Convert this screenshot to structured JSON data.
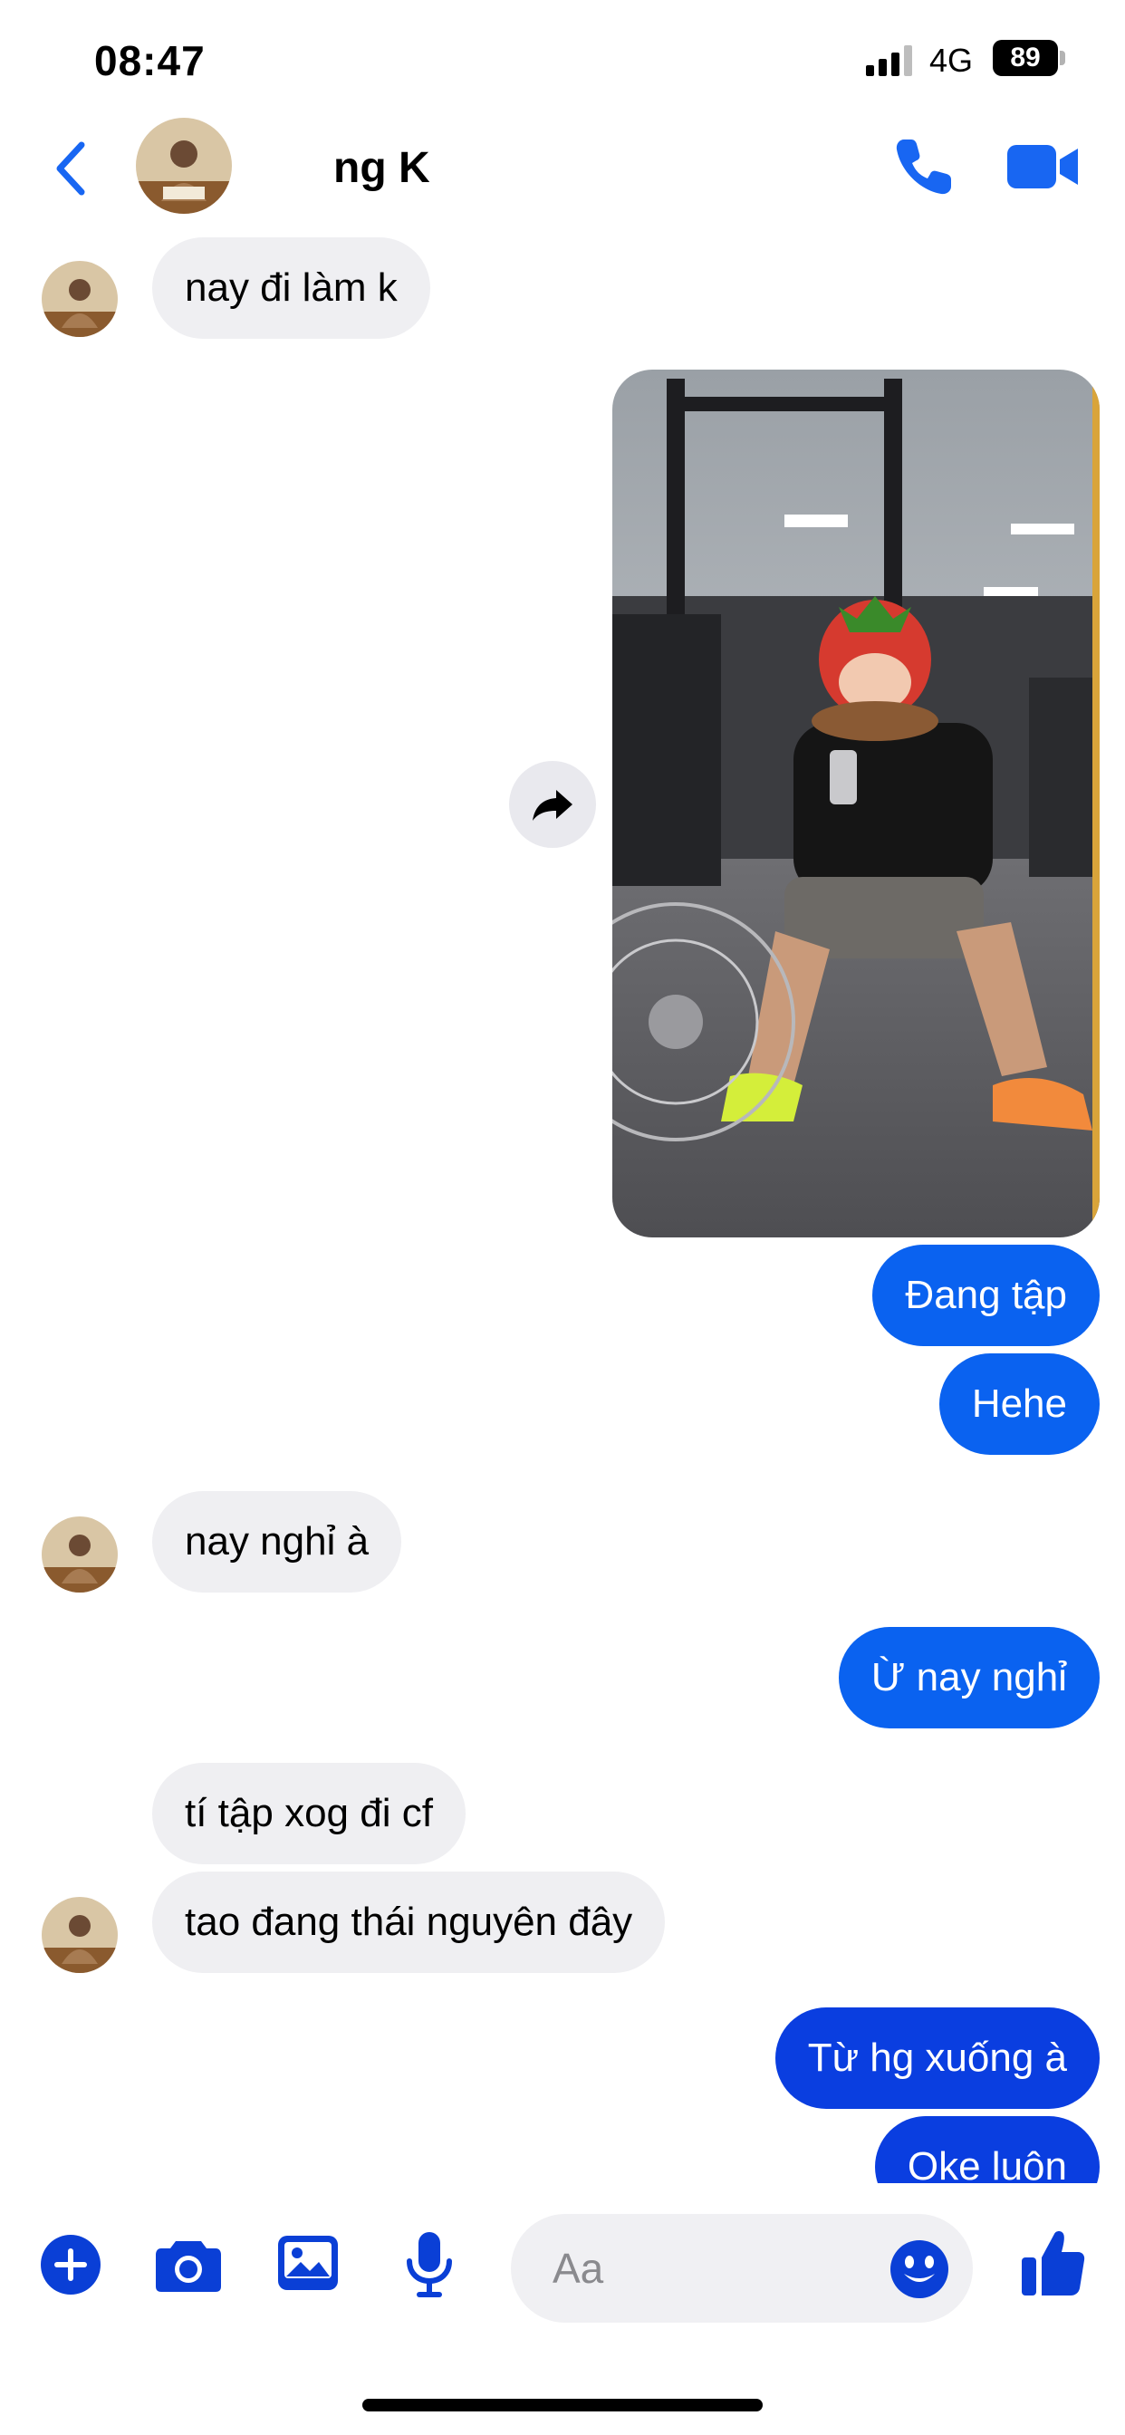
{
  "status_bar": {
    "time": "08:47",
    "network": "4G",
    "battery": "89"
  },
  "header": {
    "contact_name": "ng K"
  },
  "messages": {
    "m1": "nay đi làm k",
    "m2": "Đang tập",
    "m3": "Hehe",
    "m4": "nay nghỉ à",
    "m5": "Ừ nay nghỉ",
    "m6": "tí tập xog đi cf",
    "m7": "tao đang thái nguyên đây",
    "m8": "Từ hg xuống à",
    "m9": "Oke luôn"
  },
  "composer": {
    "placeholder": "Aa"
  },
  "colors": {
    "accent": "#0a62f0",
    "accent_deep": "#0a3ee0",
    "incoming_bubble": "#efeff2",
    "icon_blue": "#0a3fd6"
  },
  "icons": [
    "back-chevron-icon",
    "phone-icon",
    "video-camera-icon",
    "forward-icon",
    "plus-icon",
    "camera-icon",
    "image-icon",
    "microphone-icon",
    "emoji-icon",
    "thumbs-up-icon"
  ]
}
